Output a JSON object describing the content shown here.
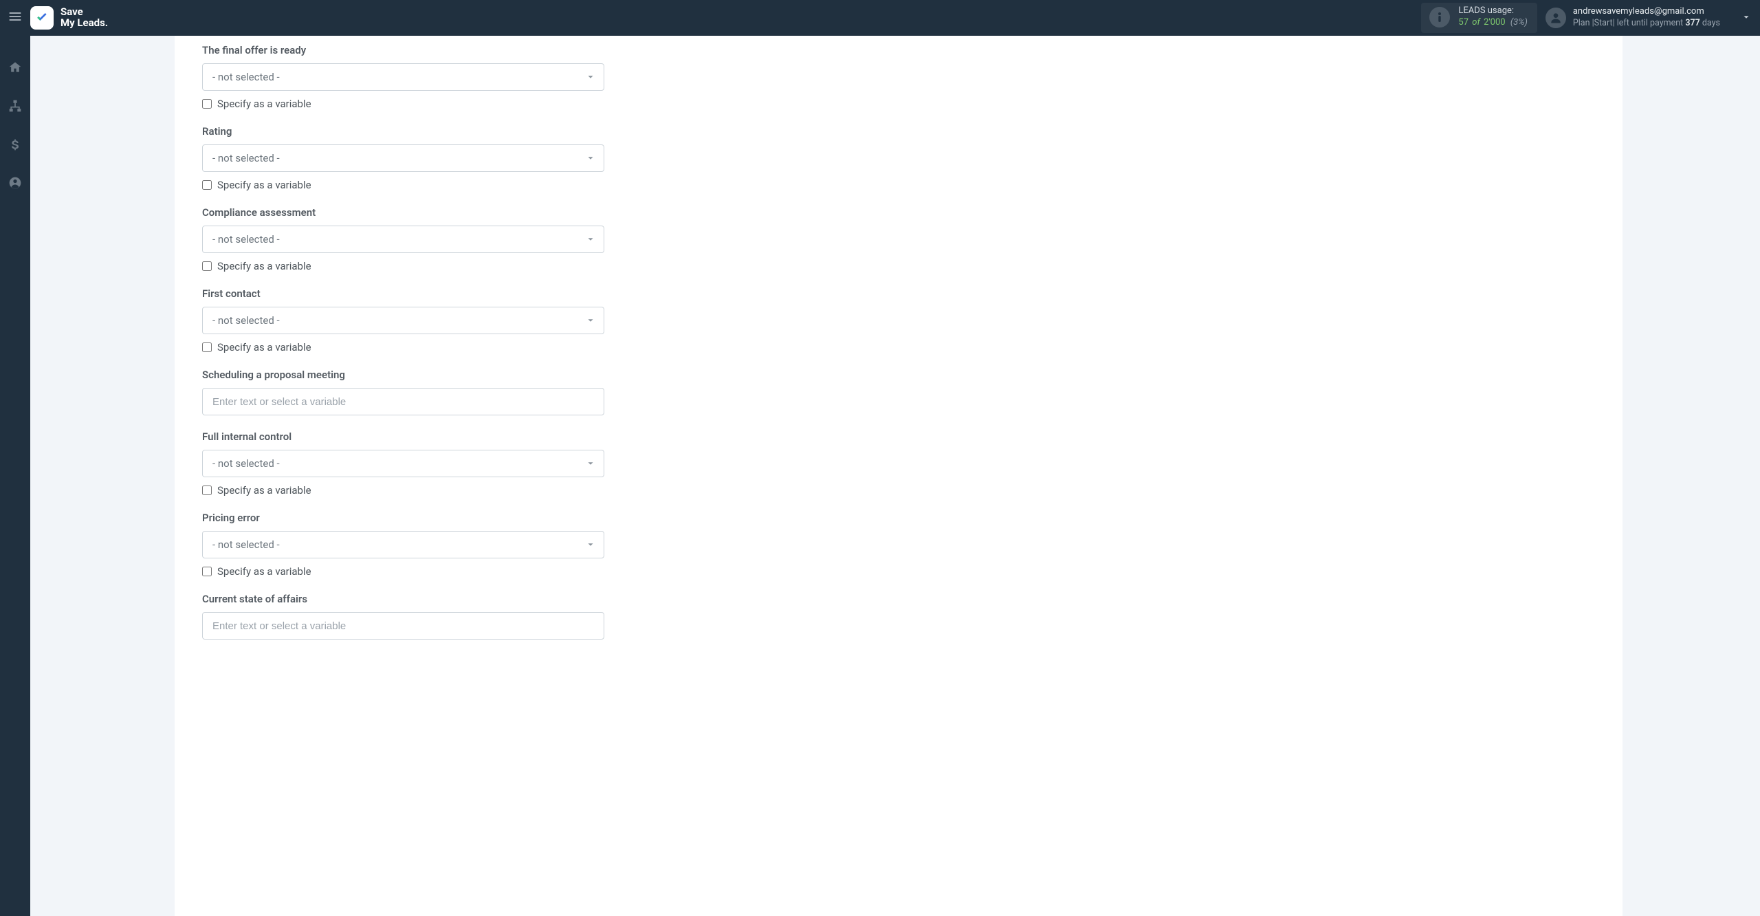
{
  "header": {
    "logo_line1": "Save",
    "logo_line2": "My Leads.",
    "usage_label": "LEADS usage:",
    "usage_used": "57",
    "usage_of": "of",
    "usage_total": "2'000",
    "usage_pct": "(3%)",
    "user_email": "andrewsavemyleads@gmail.com",
    "plan_prefix": "Plan |Start| left until payment ",
    "plan_days_num": "377",
    "plan_days_suffix": " days"
  },
  "shared": {
    "not_selected": "- not selected -",
    "specify_variable": "Specify as a variable",
    "text_placeholder": "Enter text or select a variable"
  },
  "fields": {
    "f0": {
      "label": "The final offer is ready"
    },
    "f1": {
      "label": "Rating"
    },
    "f2": {
      "label": "Compliance assessment"
    },
    "f3": {
      "label": "First contact"
    },
    "f4": {
      "label": "Scheduling a proposal meeting"
    },
    "f5": {
      "label": "Full internal control"
    },
    "f6": {
      "label": "Pricing error"
    },
    "f7": {
      "label": "Current state of affairs"
    }
  }
}
